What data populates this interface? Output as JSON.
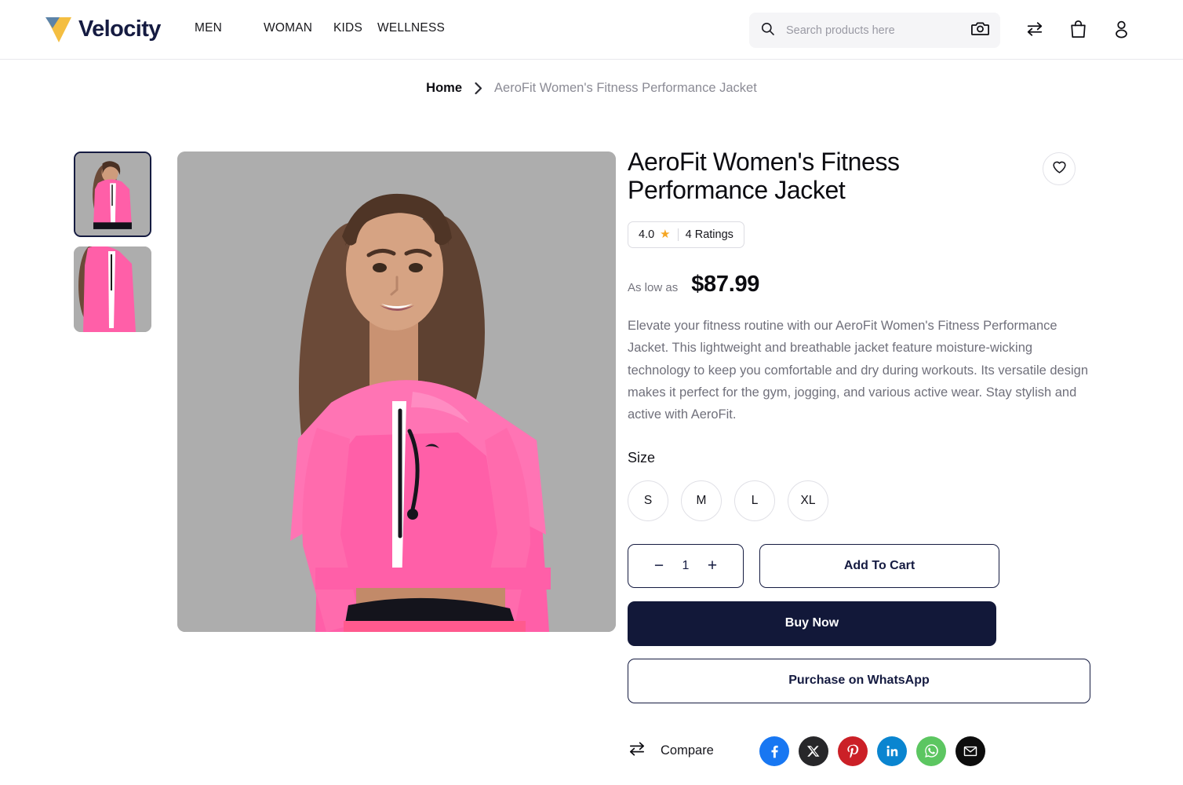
{
  "header": {
    "logo_text": "Velocity",
    "nav": [
      {
        "label": "MEN"
      },
      {
        "label": "WOMAN"
      },
      {
        "label": "KIDS"
      },
      {
        "label": "WELLNESS"
      }
    ],
    "search": {
      "placeholder": "Search products here",
      "value": "",
      "search_icon": "search-icon",
      "camera_icon": "camera-icon"
    },
    "icons": [
      {
        "name": "compare-icon"
      },
      {
        "name": "shopping-bag-icon"
      },
      {
        "name": "user-account-icon"
      }
    ]
  },
  "breadcrumb": {
    "home": "Home",
    "separator_icon": "chevron-right-icon",
    "current": "AeroFit Women's Fitness Performance Jacket"
  },
  "gallery": {
    "thumbnails": [
      {
        "alt": "AeroFit pink jacket front view",
        "active": true
      },
      {
        "alt": "AeroFit pink jacket close-up view",
        "active": false
      }
    ],
    "main_image_alt": "Model wearing AeroFit pink fitness performance jacket"
  },
  "product": {
    "title": "AeroFit Women's Fitness Performance Jacket",
    "wishlist_icon": "heart-icon",
    "rating": {
      "score": "4.0",
      "star_icon": "star-icon",
      "count_label": "4 Ratings"
    },
    "price": {
      "label": "As low as",
      "value": "$87.99"
    },
    "description": "Elevate your fitness routine with our AeroFit Women's Fitness Performance Jacket. This lightweight and breathable jacket feature moisture-wicking technology to keep you comfortable and dry during workouts. Its versatile design makes it perfect for the gym, jogging, and various active wear. Stay stylish and active with AeroFit.",
    "size": {
      "label": "Size",
      "options": [
        {
          "label": "S"
        },
        {
          "label": "M"
        },
        {
          "label": "L"
        },
        {
          "label": "XL"
        }
      ]
    },
    "quantity": {
      "decrement_label": "−",
      "value": "1",
      "increment_label": "+"
    },
    "actions": {
      "add_to_cart": "Add To Cart",
      "buy_now": "Buy Now",
      "whatsapp": "Purchase on WhatsApp"
    },
    "share": {
      "compare_label": "Compare",
      "compare_icon": "compare-icon",
      "socials": [
        {
          "name": "facebook-icon",
          "color": "#1877F2"
        },
        {
          "name": "x-twitter-icon",
          "color": "#27272A"
        },
        {
          "name": "pinterest-icon",
          "color": "#CB2027"
        },
        {
          "name": "linkedin-icon",
          "color": "#0A85D0"
        },
        {
          "name": "whatsapp-icon",
          "color": "#5CC661"
        },
        {
          "name": "email-icon",
          "color": "#0D0D0D"
        }
      ]
    }
  },
  "colors": {
    "brand_navy": "#151B41",
    "brand_yellow": "#F4BE41",
    "star_orange": "#F5A623",
    "image_bg": "#ADADAD"
  }
}
